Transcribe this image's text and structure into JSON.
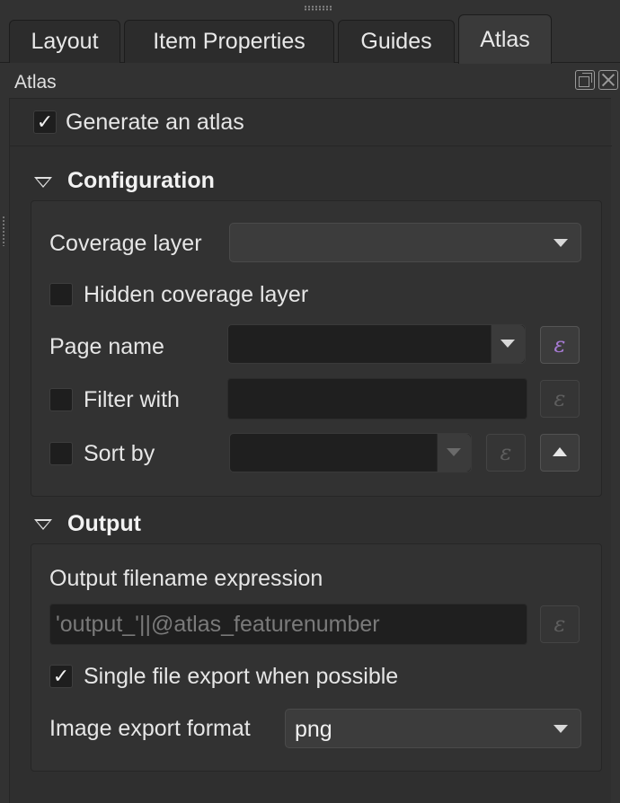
{
  "tabs": [
    {
      "label": "Layout"
    },
    {
      "label": "Item Properties"
    },
    {
      "label": "Guides"
    },
    {
      "label": "Atlas"
    }
  ],
  "active_tab": "Atlas",
  "dock": {
    "title": "Atlas"
  },
  "generate": {
    "label": "Generate an atlas",
    "checked": true,
    "mark": "✓"
  },
  "configuration": {
    "heading": "Configuration",
    "coverage_layer_label": "Coverage layer",
    "coverage_layer_value": "",
    "hidden_coverage_label": "Hidden coverage layer",
    "page_name_label": "Page name",
    "page_name_value": "",
    "filter_label": "Filter with",
    "filter_value": "",
    "sort_label": "Sort by",
    "sort_value": "",
    "expr_glyph": "ε"
  },
  "output": {
    "heading": "Output",
    "filename_label": "Output filename expression",
    "filename_value": "'output_'||@atlas_featurenumber",
    "single_file_label": "Single file export when possible",
    "single_file_mark": "✓",
    "image_format_label": "Image export format",
    "image_format_value": "png"
  },
  "icons": {
    "expression": "expression-epsilon-icon",
    "dropdown": "chevron-down-icon",
    "sort_up": "arrow-up-icon",
    "float": "float-window-icon",
    "close": "close-icon"
  },
  "colors": {
    "background": "#323232",
    "expression_active": "#a77bd4"
  }
}
